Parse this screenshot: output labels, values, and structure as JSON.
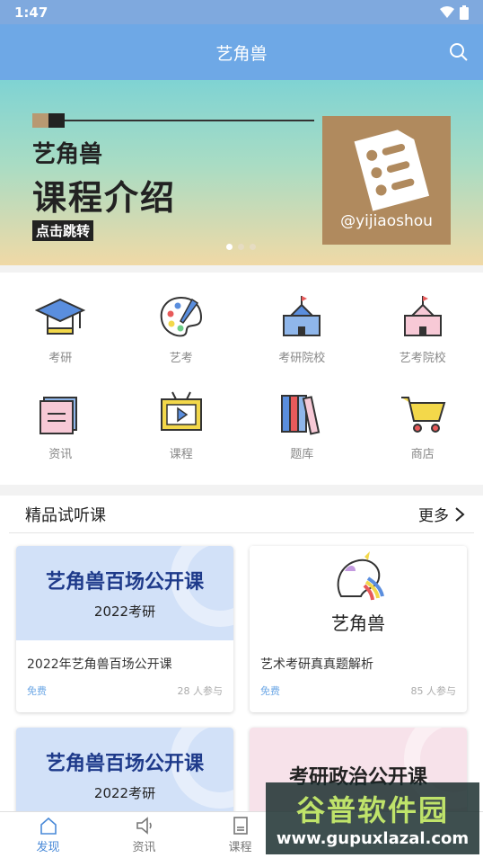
{
  "status": {
    "time": "1:47"
  },
  "appbar": {
    "title": "艺角兽"
  },
  "banner": {
    "brand": "艺角兽",
    "heading": "课程介绍",
    "cta": "点击跳转",
    "handle": "@yijiaoshou"
  },
  "grid": [
    {
      "label": "考研",
      "icon": "graduation-cap-icon"
    },
    {
      "label": "艺考",
      "icon": "palette-icon"
    },
    {
      "label": "考研院校",
      "icon": "school-building-icon"
    },
    {
      "label": "艺考院校",
      "icon": "art-school-icon"
    },
    {
      "label": "资讯",
      "icon": "news-icon"
    },
    {
      "label": "课程",
      "icon": "tv-play-icon"
    },
    {
      "label": "题库",
      "icon": "books-icon"
    },
    {
      "label": "商店",
      "icon": "cart-icon"
    }
  ],
  "section": {
    "title": "精品试听课",
    "more": "更多"
  },
  "courses": [
    {
      "cover_title": "艺角兽百场公开课",
      "cover_sub": "2022考研",
      "title": "2022年艺角兽百场公开课",
      "price": "免费",
      "count": "28 人参与"
    },
    {
      "cover_title": "艺角兽",
      "cover_sub": "",
      "title": "艺术考研真真题解析",
      "price": "免费",
      "count": "85 人参与"
    },
    {
      "cover_title": "艺角兽百场公开课",
      "cover_sub": "2022考研"
    },
    {
      "cover_title": "考研政治公开课",
      "cover_sub": ""
    }
  ],
  "tabs": [
    {
      "label": "发现",
      "icon": "home-icon"
    },
    {
      "label": "资讯",
      "icon": "speaker-icon"
    },
    {
      "label": "课程",
      "icon": "document-icon"
    }
  ],
  "watermark": {
    "name": "谷普软件园",
    "url": "www.gupuxlazal.com"
  },
  "colors": {
    "primary": "#6ea8e6",
    "status": "#7fa9de",
    "accent_text": "#1e3a8a"
  }
}
